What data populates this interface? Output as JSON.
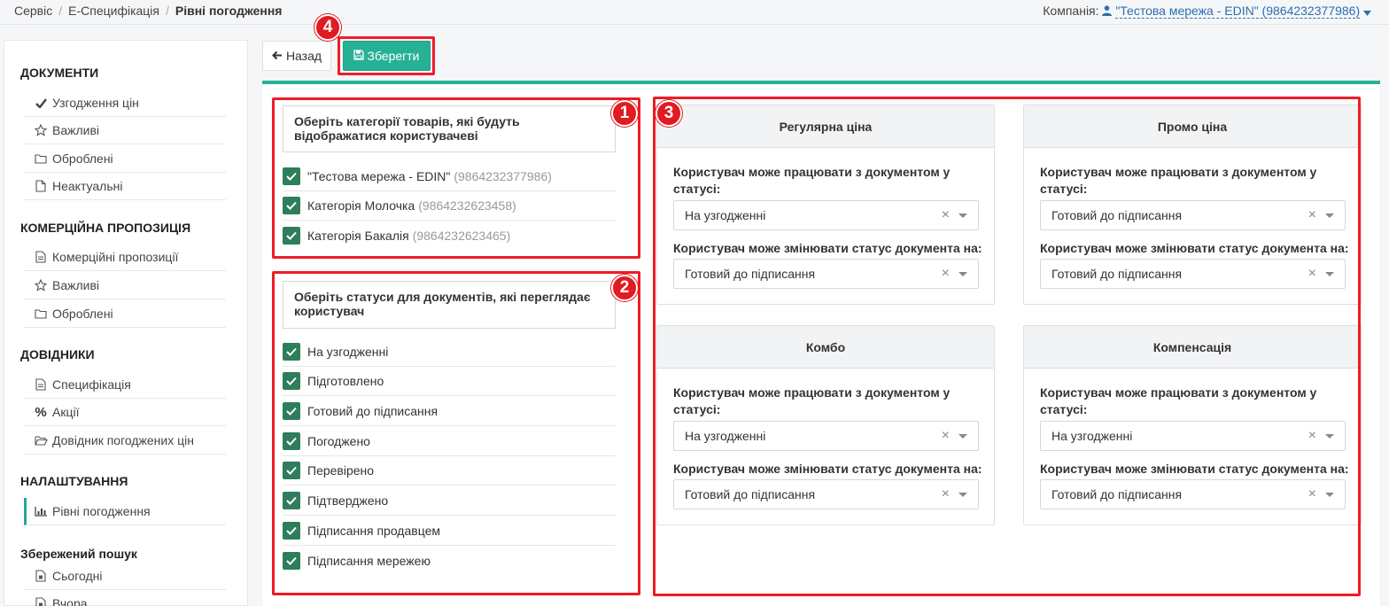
{
  "breadcrumb": {
    "item1": "Сервіс",
    "sep": "/",
    "item2": "Е-Специфікація",
    "current": "Рівні погодження"
  },
  "company": {
    "label": "Компанія:",
    "value": "\"Тестова мережа - EDIN\" (9864232377986)"
  },
  "sidebar": {
    "documents": {
      "title": "ДОКУМЕНТИ",
      "items": [
        {
          "label": "Узгодження цін",
          "icon": "check-icon"
        },
        {
          "label": "Важливі",
          "icon": "star-icon"
        },
        {
          "label": "Оброблені",
          "icon": "folder-icon"
        },
        {
          "label": "Неактуальні",
          "icon": "file-icon"
        }
      ]
    },
    "commercial": {
      "title": "КОМЕРЦІЙНА ПРОПОЗИЦІЯ",
      "items": [
        {
          "label": "Комерційні пропозиції",
          "icon": "document-icon"
        },
        {
          "label": "Важливі",
          "icon": "star-icon"
        },
        {
          "label": "Оброблені",
          "icon": "folder-icon"
        }
      ]
    },
    "refs": {
      "title": "ДОВІДНИКИ",
      "items": [
        {
          "label": "Специфікація",
          "icon": "document-icon"
        },
        {
          "label": "Акції",
          "icon": "percent-icon"
        },
        {
          "label": "Довідник погоджених цін",
          "icon": "folder-open-icon"
        }
      ]
    },
    "settings": {
      "title": "НАЛАШТУВАННЯ",
      "items": [
        {
          "label": "Рівні погодження",
          "icon": "bar-chart-icon",
          "active": true
        }
      ]
    },
    "saved": {
      "title": "Збережений пошук",
      "items": [
        {
          "label": "Сьогодні",
          "icon": "calendar-file-icon"
        },
        {
          "label": "Вчора",
          "icon": "calendar-file-icon"
        }
      ]
    }
  },
  "toolbar": {
    "back_label": "Назад",
    "save_label": "Зберегти"
  },
  "annotations": {
    "b1": "1",
    "b2": "2",
    "b3": "3",
    "b4": "4"
  },
  "categories": {
    "heading": "Оберіть категорії товарів, які будуть відображатися користувачеві",
    "items": [
      {
        "name": "\"Тестова мережа - EDIN\"",
        "code": "(9864232377986)",
        "checked": true
      },
      {
        "name": "Категорія Молочка",
        "code": "(9864232623458)",
        "checked": true
      },
      {
        "name": "Категорія Бакалія",
        "code": "(9864232623465)",
        "checked": true
      }
    ]
  },
  "statuses": {
    "heading": "Оберіть статуси для документів, які переглядає користувач",
    "items": [
      {
        "name": "На узгодженні",
        "checked": true
      },
      {
        "name": "Підготовлено",
        "checked": true
      },
      {
        "name": "Готовий до підписання",
        "checked": true
      },
      {
        "name": "Погоджено",
        "checked": true
      },
      {
        "name": "Перевірено",
        "checked": true
      },
      {
        "name": "Підтверджено",
        "checked": true
      },
      {
        "name": "Підписання продавцем",
        "checked": true
      },
      {
        "name": "Підписання мережею",
        "checked": true
      }
    ]
  },
  "price_types": [
    {
      "title": "Регулярна ціна",
      "work_label": "Користувач може працювати з документом у статусі:",
      "work_value": "На узгодженні",
      "change_label": "Користувач може змінювати статус документа на:",
      "change_value": "Готовий до підписання"
    },
    {
      "title": "Промо ціна",
      "work_label": "Користувач може працювати з документом у статусі:",
      "work_value": "Готовий до підписання",
      "change_label": "Користувач може змінювати статус документа на:",
      "change_value": "Готовий до підписання"
    },
    {
      "title": "Комбо",
      "work_label": "Користувач може працювати з документом у статусі:",
      "work_value": "На узгодженні",
      "change_label": "Користувач може змінювати статус документа на:",
      "change_value": "Готовий до підписання"
    },
    {
      "title": "Компенсація",
      "work_label": "Користувач може працювати з документом у статусі:",
      "work_value": "На узгодженні",
      "change_label": "Користувач може змінювати статус документа на:",
      "change_value": "Готовий до підписання"
    }
  ],
  "select_clear_glyph": "×",
  "colors": {
    "accent": "#26b197",
    "checkbox": "#2e7d5b",
    "highlight": "#ee1c25",
    "link": "#2c6fb0"
  }
}
